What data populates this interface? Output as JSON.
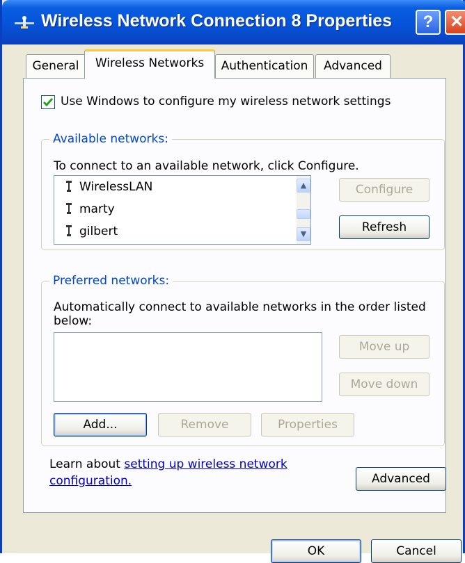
{
  "window": {
    "title": "Wireless Network Connection 8 Properties",
    "help_glyph": "?",
    "close_glyph": "✕"
  },
  "tabs": [
    {
      "label": "General",
      "active": false
    },
    {
      "label": "Wireless Networks",
      "active": true
    },
    {
      "label": "Authentication",
      "active": false
    },
    {
      "label": "Advanced",
      "active": false
    }
  ],
  "settings": {
    "use_windows_label": "Use Windows to configure my wireless network settings",
    "use_windows_checked": true
  },
  "available": {
    "group_title": "Available networks:",
    "instruction": "To connect to an available network, click Configure.",
    "networks": [
      "WirelessLAN",
      "marty",
      "gilbert"
    ],
    "configure_label": "Configure",
    "refresh_label": "Refresh"
  },
  "preferred": {
    "group_title": "Preferred networks:",
    "instruction_line1": "Automatically connect to available networks in the order listed",
    "instruction_line2": "below:",
    "move_up_label": "Move up",
    "move_down_label": "Move down",
    "add_label": "Add...",
    "remove_label": "Remove",
    "properties_label": "Properties"
  },
  "footer": {
    "learn_prefix": "Learn about ",
    "learn_link_line1": "setting up wireless network",
    "learn_link_line2": "configuration.",
    "advanced_label": "Advanced"
  },
  "dialog": {
    "ok_label": "OK",
    "cancel_label": "Cancel"
  },
  "colors": {
    "titlebar": "#0553da",
    "group_title": "#0046d5",
    "link": "#0000cc",
    "face": "#ece9d8"
  }
}
